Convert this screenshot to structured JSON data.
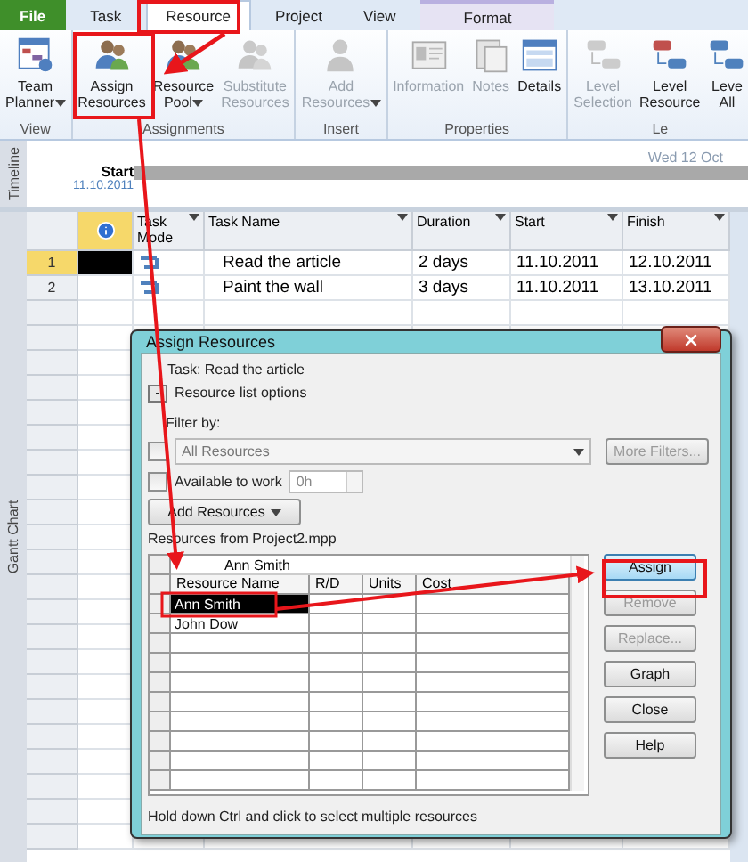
{
  "ribbon_tabs": [
    {
      "label": "File",
      "kind": "file",
      "selected": false
    },
    {
      "label": "Task",
      "kind": "normal",
      "selected": false
    },
    {
      "label": "Resource",
      "kind": "normal",
      "selected": true
    },
    {
      "label": "Project",
      "kind": "normal",
      "selected": false
    },
    {
      "label": "View",
      "kind": "normal",
      "selected": false
    },
    {
      "label": "Format",
      "kind": "contextual",
      "selected": false
    }
  ],
  "ribbon_groups": [
    {
      "label": "View",
      "commands": [
        {
          "label": "Team\nPlanner",
          "dropdown": true,
          "disabled": false
        }
      ]
    },
    {
      "label": "Assignments",
      "commands": [
        {
          "label": "Assign\nResources",
          "dropdown": false,
          "disabled": false
        },
        {
          "label": "Resource\nPool",
          "dropdown": true,
          "disabled": false
        },
        {
          "label": "Substitute\nResources",
          "dropdown": false,
          "disabled": true
        }
      ]
    },
    {
      "label": "Insert",
      "commands": [
        {
          "label": "Add\nResources",
          "dropdown": true,
          "disabled": true
        }
      ]
    },
    {
      "label": "Properties",
      "commands": [
        {
          "label": "Information",
          "dropdown": false,
          "disabled": true
        },
        {
          "label": "Notes",
          "dropdown": false,
          "disabled": true
        },
        {
          "label": "Details",
          "dropdown": false,
          "disabled": false
        }
      ]
    },
    {
      "label": "Le",
      "commands": [
        {
          "label": "Level\nSelection",
          "dropdown": false,
          "disabled": true
        },
        {
          "label": "Level\nResource",
          "dropdown": false,
          "disabled": false
        },
        {
          "label": "Leve\nAll",
          "dropdown": false,
          "disabled": false
        }
      ]
    }
  ],
  "timeline": {
    "side_label": "Timeline",
    "start_label": "Start",
    "start_date": "11.10.2011",
    "scale_label": "Wed 12 Oct"
  },
  "view_label": "Gantt Chart",
  "table": {
    "columns": [
      "Task\nMode",
      "Task Name",
      "Duration",
      "Start",
      "Finish"
    ],
    "rows": [
      {
        "id": "1",
        "name": "Read the article",
        "duration": "2 days",
        "start": "11.10.2011",
        "finish": "12.10.2011",
        "selected": true
      },
      {
        "id": "2",
        "name": "Paint the wall",
        "duration": "3 days",
        "start": "11.10.2011",
        "finish": "13.10.2011",
        "selected": false
      }
    ]
  },
  "dialog": {
    "title": "Assign Resources",
    "task_label": "Task: Read the article",
    "options_toggle": "-",
    "options_label": "Resource list options",
    "filter_label": "Filter by:",
    "filter_checked": false,
    "filter_value": "All Resources",
    "more_filters": "More Filters...",
    "available_label": "Available to work",
    "available_checked": false,
    "available_value": "0h",
    "add_resources": "Add Resources",
    "resources_label": "Resources from Project2.mpp",
    "entry_value": "Ann Smith",
    "columns": [
      "Resource Name",
      "R/D",
      "Units",
      "Cost"
    ],
    "resources": [
      {
        "name": "Ann Smith",
        "selected": true
      },
      {
        "name": "John Dow",
        "selected": false
      }
    ],
    "buttons": [
      {
        "label": "Assign",
        "disabled": false,
        "focused": true
      },
      {
        "label": "Remove",
        "disabled": true,
        "focused": false
      },
      {
        "label": "Replace...",
        "disabled": true,
        "focused": false
      },
      {
        "label": "Graph",
        "disabled": false,
        "focused": false
      },
      {
        "label": "Close",
        "disabled": false,
        "focused": false
      },
      {
        "label": "Help",
        "disabled": false,
        "focused": false
      }
    ],
    "hint": "Hold down Ctrl and click to select multiple resources"
  }
}
